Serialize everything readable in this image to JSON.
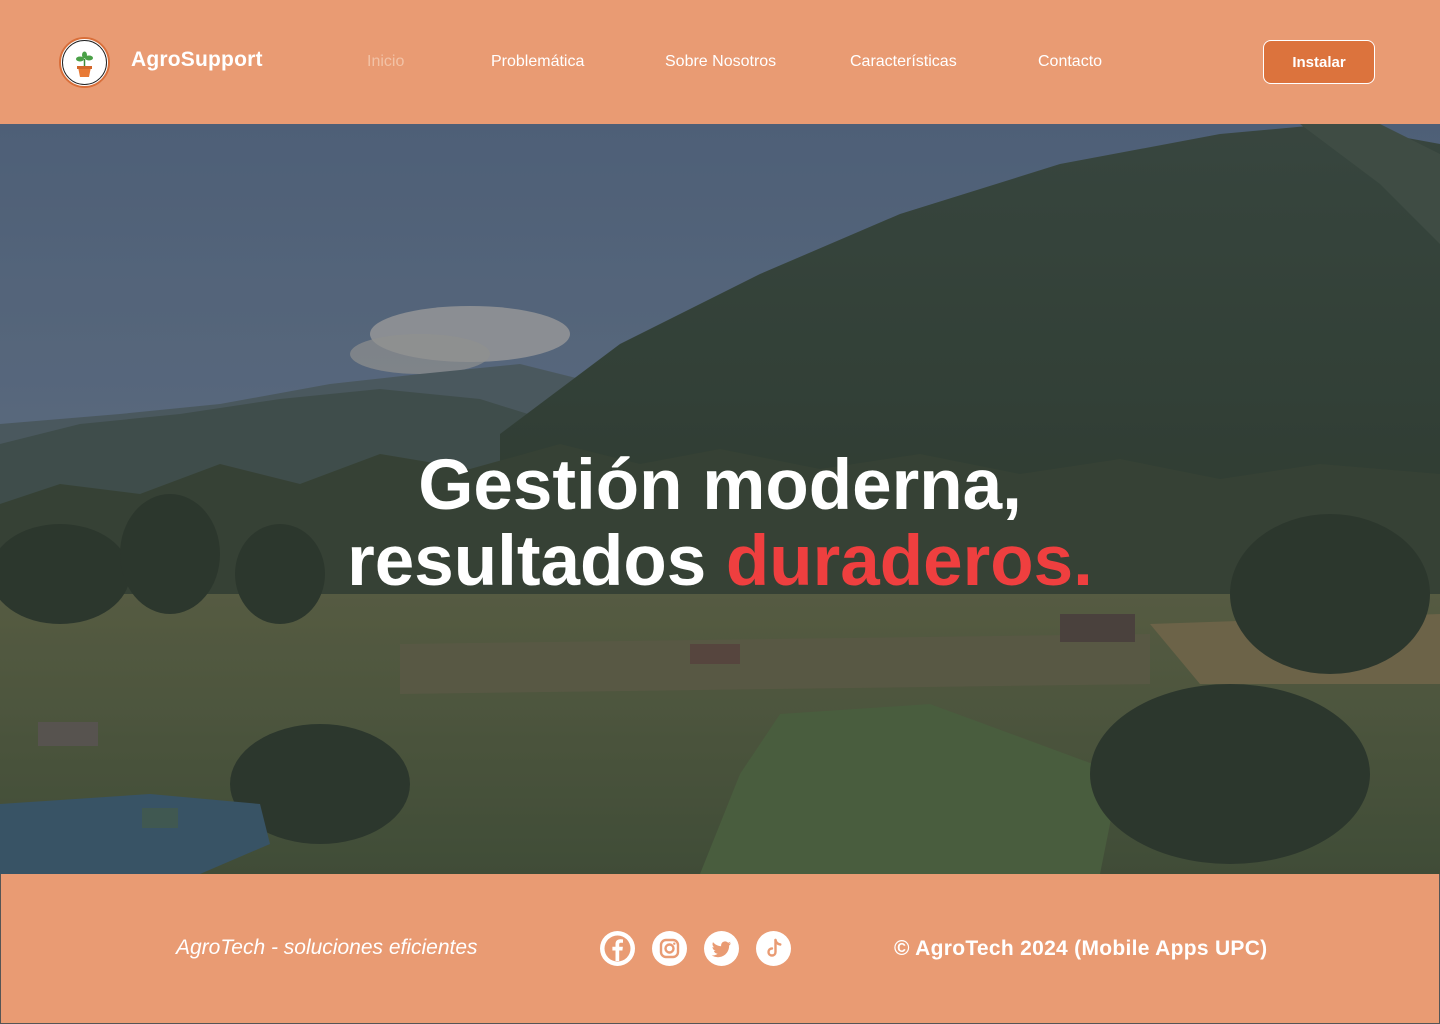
{
  "header": {
    "brand": "AgroSupport",
    "logo_text": "AgroSupport",
    "nav": [
      {
        "label": "Inicio",
        "active": true
      },
      {
        "label": "Problemática",
        "active": false
      },
      {
        "label": "Sobre Nosotros",
        "active": false
      },
      {
        "label": "Características",
        "active": false
      },
      {
        "label": "Contacto",
        "active": false
      }
    ],
    "install_label": "Instalar"
  },
  "hero": {
    "line1": "Gestión moderna,",
    "line2_plain": "resultados ",
    "line2_accent": "duraderos."
  },
  "footer": {
    "tagline": "AgroTech - soluciones eficientes",
    "social": [
      "facebook-icon",
      "instagram-icon",
      "twitter-icon",
      "tiktok-icon"
    ],
    "copyright": "© AgroTech 2024 (Mobile Apps UPC)"
  },
  "colors": {
    "bar_bg": "#e99b73",
    "button_bg": "#dc733d",
    "accent_red": "#ef3f3f",
    "active_nav": "#f2c2a6"
  }
}
